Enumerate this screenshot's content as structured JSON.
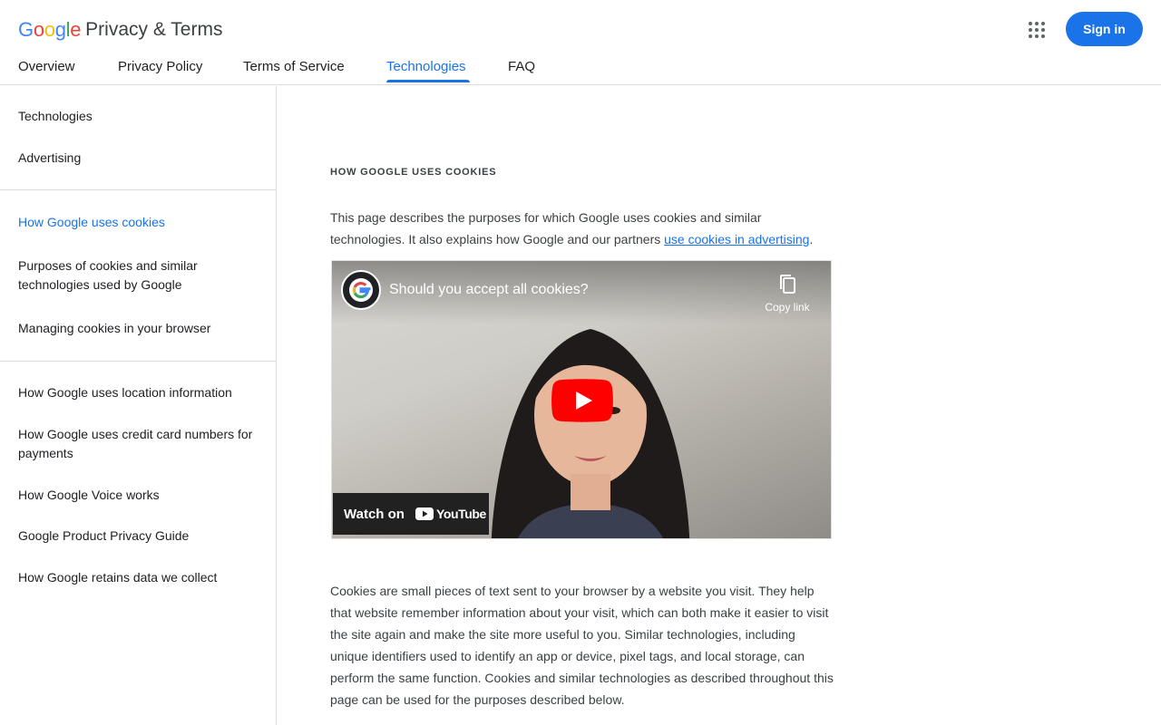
{
  "header": {
    "logo": {
      "letters": [
        {
          "ch": "G",
          "color": "#4285F4"
        },
        {
          "ch": "o",
          "color": "#EA4335"
        },
        {
          "ch": "o",
          "color": "#FBBC05"
        },
        {
          "ch": "g",
          "color": "#4285F4"
        },
        {
          "ch": "l",
          "color": "#34A853"
        },
        {
          "ch": "e",
          "color": "#EA4335"
        }
      ]
    },
    "title": "Privacy & Terms",
    "apps_icon": "apps-grid-icon",
    "sign_in": "Sign in"
  },
  "tabs": [
    {
      "label": "Overview",
      "active": false
    },
    {
      "label": "Privacy Policy",
      "active": false
    },
    {
      "label": "Terms of Service",
      "active": false
    },
    {
      "label": "Technologies",
      "active": true
    },
    {
      "label": "FAQ",
      "active": false
    }
  ],
  "sidebar": {
    "top": [
      "Technologies",
      "Advertising"
    ],
    "section1": [
      "How Google uses cookies",
      "Purposes of cookies and similar technologies used by Google",
      "Managing cookies in your browser"
    ],
    "section2": [
      "How Google uses location information",
      "How Google uses credit card numbers for payments",
      "How Google Voice works",
      "Google Product Privacy Guide",
      "How Google retains data we collect"
    ],
    "active": "How Google uses cookies"
  },
  "main": {
    "eyebrow": "HOW GOOGLE USES COOKIES",
    "intro": "This page describes the purposes for which Google uses cookies and similar technologies. It also explains how Google and our partners ",
    "intro_link": "use cookies in advertising",
    "intro_end": ".",
    "video": {
      "title": "Should you accept all cookies?",
      "copy_label": "Copy link",
      "watch_label": "Watch on",
      "youtube_label": "YouTube"
    },
    "body": "Cookies are small pieces of text sent to your browser by a website you visit. They help that website remember information about your visit, which can both make it easier to visit the site again and make the site more useful to you. Similar technologies, including unique identifiers used to identify an app or device, pixel tags, and local storage, can perform the same function. Cookies and similar technologies as described throughout this page can be used for the purposes described below."
  },
  "colors": {
    "accent": "#1a73e8",
    "divider": "#dadce0",
    "youtube_red": "#FF0000"
  }
}
